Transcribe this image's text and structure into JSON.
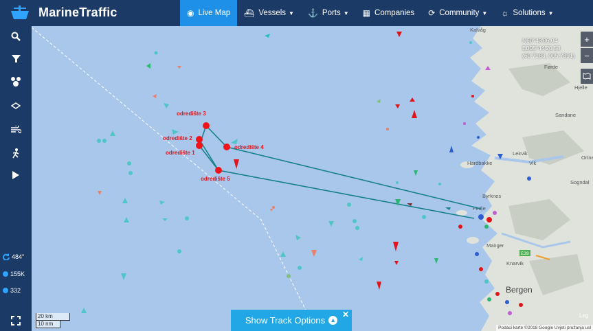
{
  "app": {
    "brand": "MarineTraffic"
  },
  "nav": [
    {
      "label": "Live Map",
      "icon": "globe-icon",
      "active": true,
      "caret": false
    },
    {
      "label": "Vessels",
      "icon": "ship-icon",
      "active": false,
      "caret": true
    },
    {
      "label": "Ports",
      "icon": "anchor-icon",
      "active": false,
      "caret": true
    },
    {
      "label": "Companies",
      "icon": "building-icon",
      "active": false,
      "caret": false
    },
    {
      "label": "Community",
      "icon": "community-icon",
      "active": false,
      "caret": true
    },
    {
      "label": "Solutions",
      "icon": "lightbulb-icon",
      "active": false,
      "caret": true
    }
  ],
  "sidebar": {
    "tools": [
      "search-icon",
      "filter-icon",
      "fleets-icon",
      "layers-icon",
      "weather-icon",
      "route-icon",
      "play-icon"
    ],
    "stats": [
      {
        "icon": "refresh-icon",
        "value": "484\""
      },
      {
        "icon": "info-icon",
        "value": "155K"
      },
      {
        "icon": "vessels-count-icon",
        "value": "332"
      }
    ]
  },
  "map": {
    "coords": [
      "N60°43'06.04",
      "E005°44'20.58",
      "(60.7183, 005.7391)"
    ],
    "scale_km": "20 km",
    "scale_nm": "10 nm",
    "attribution": "Podaci karte ©2018 Google   Uvjeti pružanja usl",
    "legend": "Leg",
    "waypoints": [
      {
        "label": "odredište 3"
      },
      {
        "label": "odredište 2"
      },
      {
        "label": "odredište 4"
      },
      {
        "label": "odredište 1"
      },
      {
        "label": "odredište 5"
      }
    ],
    "places": [
      "Kalvåg",
      "Hardbakke",
      "Byrknes",
      "Manger",
      "Knarvik",
      "Bergen",
      "Fedje",
      "Leirvik",
      "Ortnev",
      "Sandane",
      "Hjelle",
      "Vik",
      "Førde",
      "Sogndal"
    ],
    "route_labels": [
      "E39"
    ]
  },
  "controls": {
    "track_options": "Show Track Options",
    "zoom_in": "+",
    "zoom_out": "−"
  }
}
